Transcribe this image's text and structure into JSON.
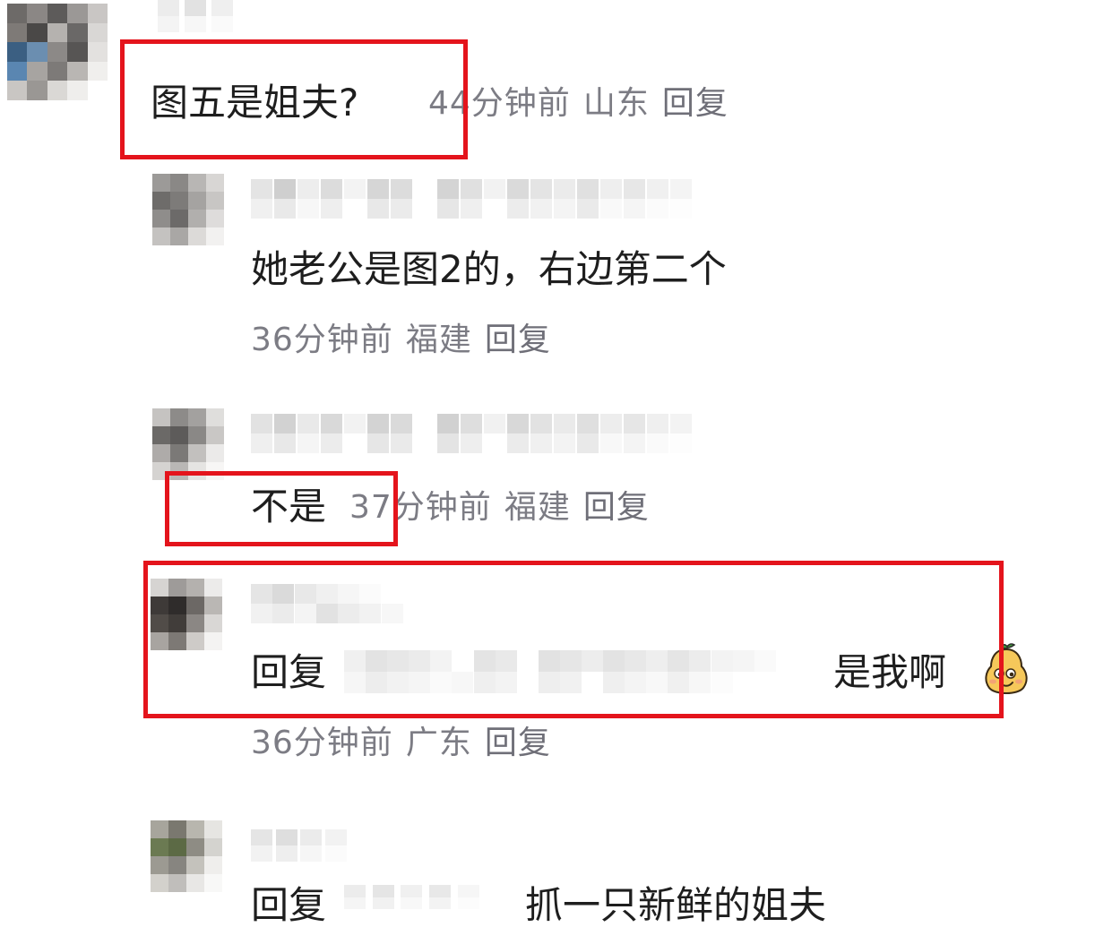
{
  "comments": [
    {
      "text": "图五是姐夫?",
      "time": "44分钟前",
      "location": "山东",
      "reply_label": "回复"
    },
    {
      "text": "她老公是图2的，右边第二个",
      "time": "36分钟前",
      "location": "福建",
      "reply_label": "回复"
    },
    {
      "text": "不是",
      "time": "37分钟前",
      "location": "福建",
      "reply_label": "回复"
    },
    {
      "prefix": "回复",
      "text": "是我啊",
      "emoji": "pear-smile-emoji",
      "time": "36分钟前",
      "location": "广东",
      "reply_label": "回复"
    },
    {
      "prefix": "回复",
      "text": "抓一只新鲜的姐夫"
    }
  ],
  "colors": {
    "highlight": "#e4141c",
    "meta_text": "#7c7c84",
    "body_text": "#1e1e1e"
  }
}
